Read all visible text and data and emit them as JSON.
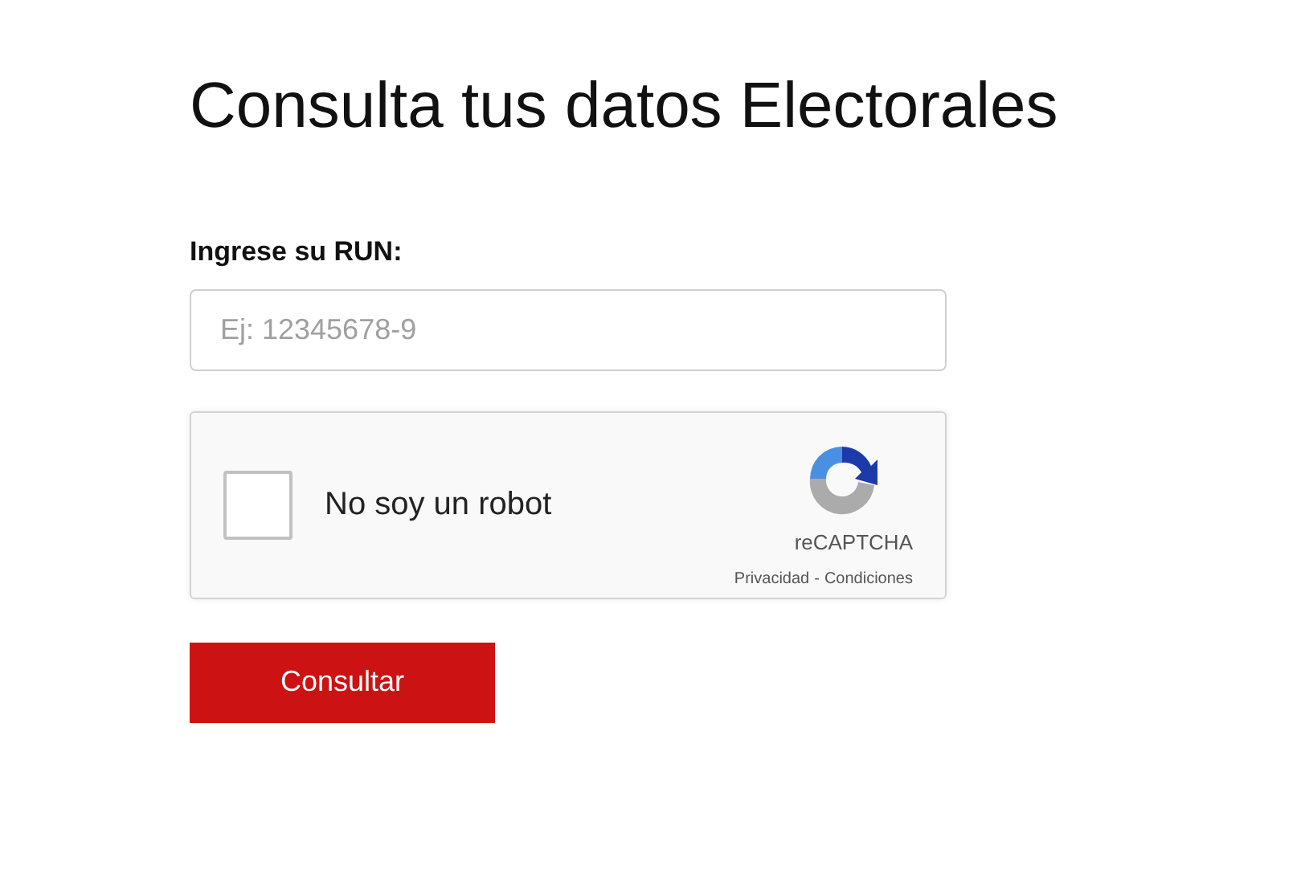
{
  "title": "Consulta tus datos Electorales",
  "run_field": {
    "label": "Ingrese su RUN:",
    "placeholder": "Ej: 12345678-9"
  },
  "captcha": {
    "checked": false,
    "label": "No soy un robot",
    "brand": "reCAPTCHA",
    "links": [
      "Privacidad",
      "Condiciones"
    ],
    "separator": "-"
  },
  "submit_button": "Consultar"
}
